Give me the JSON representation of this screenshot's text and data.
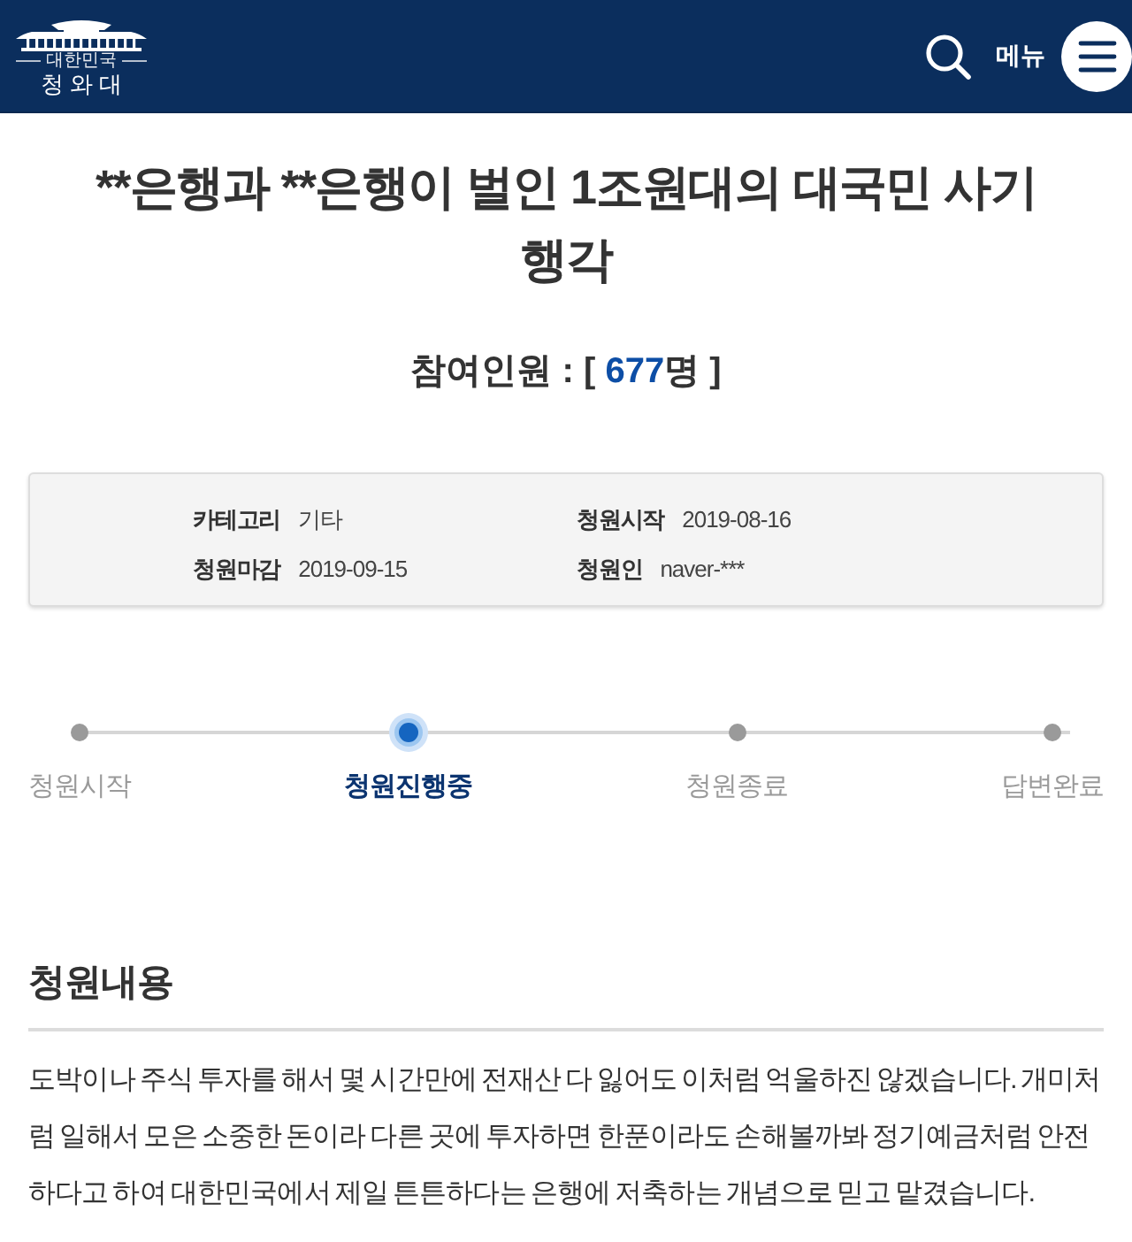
{
  "header": {
    "logo_subtitle": "대한민국",
    "logo_name": "청 와 대",
    "menu_label": "메뉴"
  },
  "petition": {
    "title": "**은행과 **은행이 벌인 1조원대의 대국민 사기 행각",
    "participants": {
      "label": "참여인원 : [ ",
      "count": "677",
      "unit": "명 ]"
    }
  },
  "info": [
    {
      "label": "카테고리",
      "value": "기타"
    },
    {
      "label": "청원시작",
      "value": "2019-08-16"
    },
    {
      "label": "청원마감",
      "value": "2019-09-15"
    },
    {
      "label": "청원인",
      "value": "naver-***"
    }
  ],
  "steps": [
    {
      "label": "청원시작",
      "selected": false
    },
    {
      "label": "청원진행중",
      "selected": true
    },
    {
      "label": "청원종료",
      "selected": false
    },
    {
      "label": "답변완료",
      "selected": false
    }
  ],
  "content": {
    "heading": "청원내용",
    "body": "도박이나 주식 투자를 해서 몇 시간만에 전재산 다 잃어도 이처럼 억울하진 않겠습니다. 개미처럼 일해서 모은 소중한 돈이라 다른 곳에 투자하면 한푼이라도 손해볼까봐 정기예금처럼 안전하다고 하여 대한민국에서 제일 튼튼하다는 은행에 저축하는 개념으로 믿고 맡겼습니다."
  }
}
